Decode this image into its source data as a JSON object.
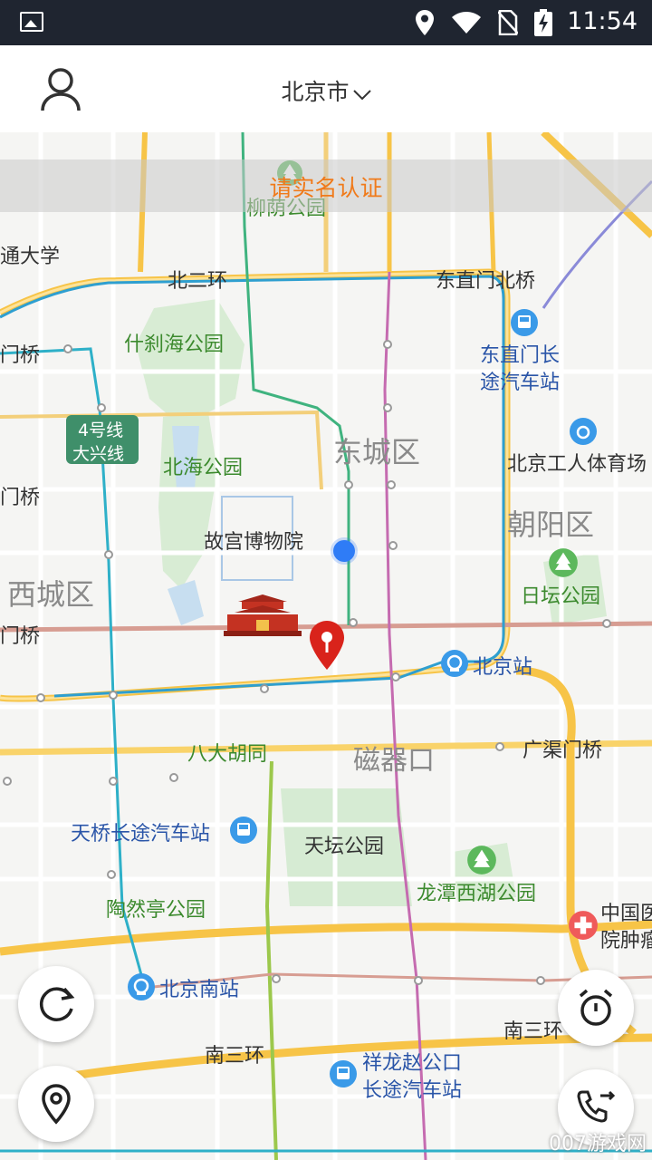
{
  "status_bar": {
    "time": "11:54"
  },
  "header": {
    "city": "北京市"
  },
  "banner": {
    "text": "请实名认证"
  },
  "map_labels": {
    "liuyin_park": "柳荫公园",
    "tong_daxue": "通大学",
    "beierhuan": "北二环",
    "dongzhimen_bridge": "东直门北桥",
    "shichahai": "什刹海公园",
    "men_qiao_1": "门桥",
    "dongzhimen_bus_1": "东直门长",
    "dongzhimen_bus_2": "途汽车站",
    "line4_1": "4号线",
    "line4_2": "大兴线",
    "dongcheng": "东城区",
    "beihai": "北海公园",
    "workers_stadium": "北京工人体育场",
    "men_qiao_2": "门桥",
    "chaoyang": "朝阳区",
    "gugong": "故宫博物院",
    "xicheng": "西城区",
    "ritan": "日坛公园",
    "men_qiao_3": "门桥",
    "beijing_station": "北京站",
    "badahutong": "八大胡同",
    "ciqikou": "磁器口",
    "guangqumen": "广渠门桥",
    "tianqiao_bus": "天桥长途汽车站",
    "tiantan": "天坛公园",
    "longtan": "龙潭西湖公园",
    "taoranting": "陶然亭公园",
    "hospital_1": "中国医",
    "hospital_2": "院肿瘤",
    "beijing_south": "北京南站",
    "nansanhuan_w": "南三环",
    "xianglong_1": "祥龙赵公口",
    "xianglong_2": "长途汽车站",
    "nansanhuan_e": "南三环"
  },
  "watermark": "007游戏网",
  "colors": {
    "green_label": "#3c8a2e",
    "blue_label": "#2a55a8",
    "district": "#8a8a8a",
    "orange": "#f07a1a",
    "pin": "#d9231b",
    "location_dot": "#2f7cf6"
  }
}
